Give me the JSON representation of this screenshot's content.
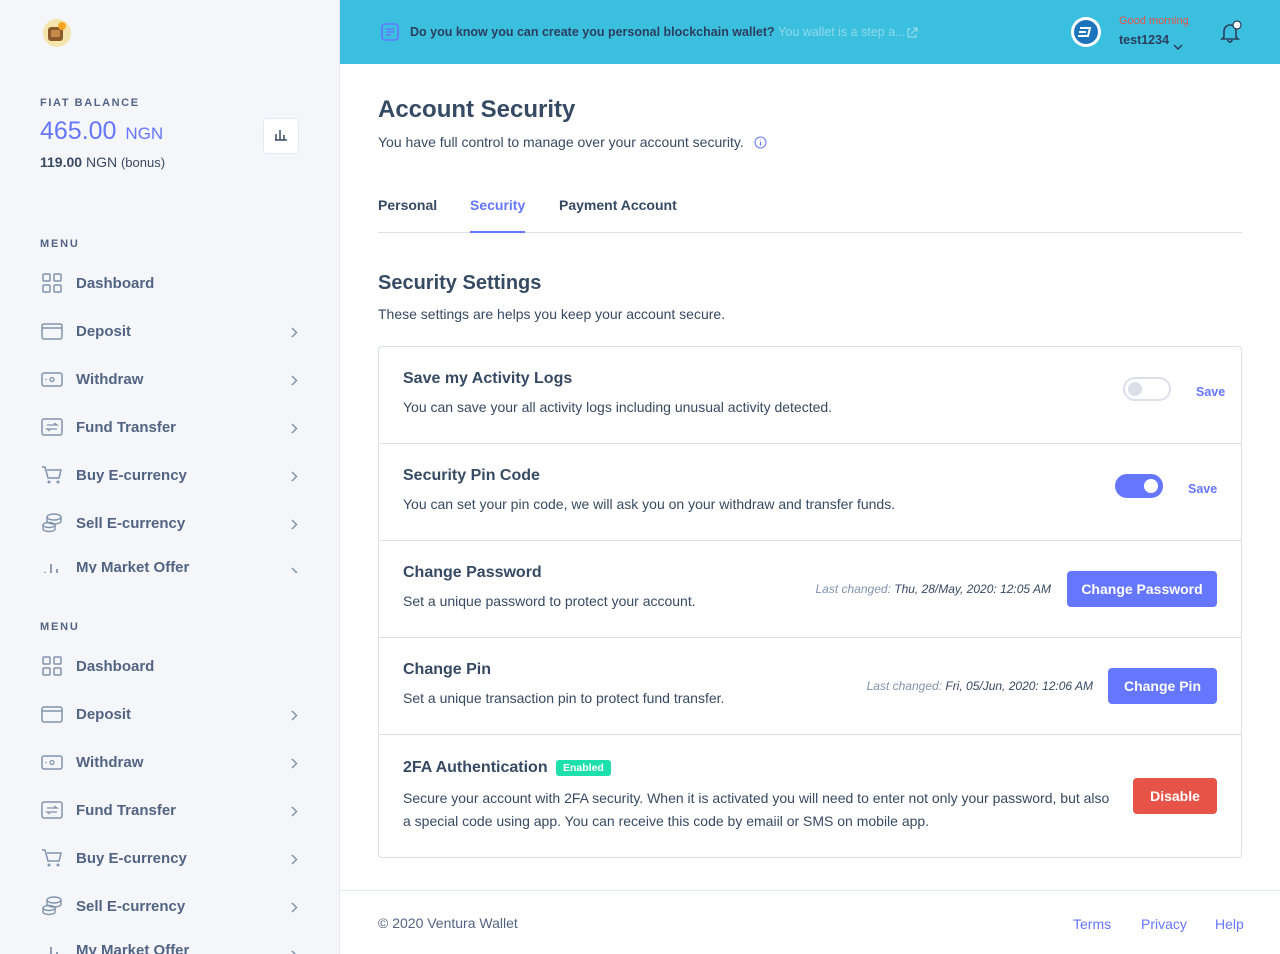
{
  "sidebar": {
    "balance_label": "FIAT BALANCE",
    "balance_amount": "465.00",
    "balance_currency": "NGN",
    "bonus_amount": "119.00",
    "bonus_currency": "NGN",
    "bonus_note": "(bonus)",
    "menus": [
      {
        "heading": "MENU",
        "items": [
          {
            "label": "Dashboard",
            "icon": "grid-icon"
          },
          {
            "label": "Deposit",
            "icon": "wallet-icon"
          },
          {
            "label": "Withdraw",
            "icon": "cash-icon"
          },
          {
            "label": "Fund Transfer",
            "icon": "transfer-icon"
          },
          {
            "label": "Buy E-currency",
            "icon": "cart-icon"
          },
          {
            "label": "Sell E-currency",
            "icon": "coins-icon"
          },
          {
            "label": "My Market Offer",
            "icon": "bar-chart-icon"
          }
        ]
      },
      {
        "heading": "MENU",
        "items": [
          {
            "label": "Dashboard",
            "icon": "grid-icon"
          },
          {
            "label": "Deposit",
            "icon": "wallet-icon"
          },
          {
            "label": "Withdraw",
            "icon": "cash-icon"
          },
          {
            "label": "Fund Transfer",
            "icon": "transfer-icon"
          },
          {
            "label": "Buy E-currency",
            "icon": "cart-icon"
          },
          {
            "label": "Sell E-currency",
            "icon": "coins-icon"
          },
          {
            "label": "My Market Offer",
            "icon": "bar-chart-icon"
          }
        ]
      }
    ]
  },
  "header": {
    "news_text": "Do you know you can create you personal blockchain wallet?",
    "news_faded": "You wallet is a step a...",
    "greeting": "Good morning",
    "username": "test1234"
  },
  "page": {
    "title": "Account Security",
    "subtitle": "You have full control to manage over your account security.",
    "tabs": [
      {
        "label": "Personal",
        "active": false
      },
      {
        "label": "Security",
        "active": true
      },
      {
        "label": "Payment Account",
        "active": false
      }
    ],
    "section_title": "Security Settings",
    "section_subtitle": "These settings are helps you keep your account secure.",
    "settings": {
      "activity_logs": {
        "title": "Save my Activity Logs",
        "desc": "You can save your all activity logs including unusual activity detected.",
        "enabled": false,
        "save_label": "Save"
      },
      "pin_code": {
        "title": "Security Pin Code",
        "desc": "You can set your pin code, we will ask you on your withdraw and transfer funds.",
        "enabled": true,
        "save_label": "Save"
      },
      "change_password": {
        "title": "Change Password",
        "desc": "Set a unique password to protect your account.",
        "last_changed_label": "Last changed:",
        "last_changed_value": "Thu, 28/May, 2020: 12:05 AM",
        "button": "Change Password"
      },
      "change_pin": {
        "title": "Change Pin",
        "desc": "Set a unique transaction pin to protect fund transfer.",
        "last_changed_label": "Last changed:",
        "last_changed_value": "Fri, 05/Jun, 2020: 12:06 AM",
        "button": "Change Pin"
      },
      "two_fa": {
        "title": "2FA Authentication",
        "badge": "Enabled",
        "desc": "Secure your account with 2FA security. When it is activated you will need to enter not only your password, but also a special code using app. You can receive this code by emaiil or SMS on mobile app.",
        "button": "Disable"
      }
    }
  },
  "footer": {
    "copyright": "© 2020 Ventura Wallet",
    "links": [
      "Terms",
      "Privacy",
      "Help"
    ]
  },
  "colors": {
    "accent": "#6576ff",
    "header_bg": "#3bbfdf",
    "danger": "#e85347",
    "success": "#1ee0ac",
    "sidebar_bg": "#f5f6fa"
  }
}
